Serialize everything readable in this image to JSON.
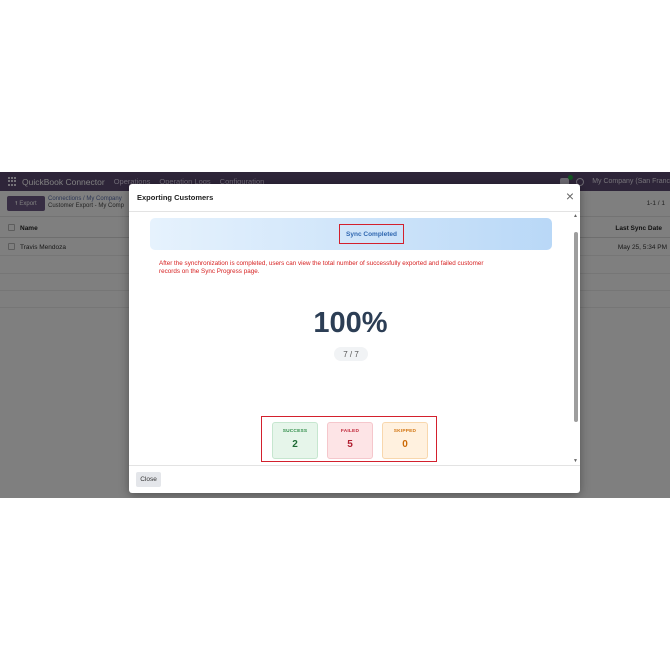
{
  "navbar": {
    "app_name": "QuickBook Connector",
    "menu": [
      "Operations",
      "Operation Logs",
      "Configuration"
    ],
    "company": "My Company (San Franc"
  },
  "control": {
    "export_label": "Export",
    "breadcrumb_links": "Connections  /  My Company",
    "breadcrumb_current": "Customer Export - My Comp",
    "pager": "1-1 / 1"
  },
  "list": {
    "headers": {
      "name": "Name",
      "last_sync": "Last Sync Date"
    },
    "rows": [
      {
        "name": "Travis Mendoza",
        "last_sync": "May 25, 5:34 PM"
      }
    ]
  },
  "modal": {
    "title": "Exporting Customers",
    "close_icon_glyph": "×",
    "banner_label": "Sync Completed",
    "note": "After the synchronization is completed, users can view the total number of successfully exported and failed customer records on the Sync Progress page.",
    "percent": "100%",
    "count": "7 / 7",
    "stats": {
      "success": {
        "label": "SUCCESS",
        "value": "2"
      },
      "failed": {
        "label": "FAILED",
        "value": "5"
      },
      "skipped": {
        "label": "SKIPPED",
        "value": "0"
      }
    },
    "close_button": "Close"
  },
  "colors": {
    "navbar": "#5c4a72",
    "highlight_border": "#d3202d",
    "note_text": "#d61f1f",
    "percent_text": "#2c3e55"
  }
}
